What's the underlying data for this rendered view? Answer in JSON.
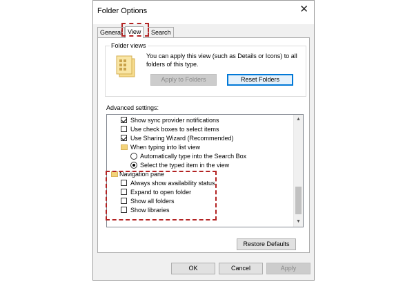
{
  "window": {
    "title": "Folder Options",
    "close_icon": "close-icon"
  },
  "tabs": [
    {
      "label": "General",
      "active": false
    },
    {
      "label": "View",
      "active": true
    },
    {
      "label": "Search",
      "active": false
    }
  ],
  "folder_views": {
    "group_label": "Folder views",
    "description": "You can apply this view (such as Details or Icons) to all folders of this type.",
    "apply_button": "Apply to Folders",
    "reset_button": "Reset Folders"
  },
  "advanced": {
    "label": "Advanced settings:",
    "items": [
      {
        "type": "checkbox",
        "label": "Show sync provider notifications",
        "checked": true
      },
      {
        "type": "checkbox",
        "label": "Use check boxes to select items",
        "checked": false
      },
      {
        "type": "checkbox",
        "label": "Use Sharing Wizard (Recommended)",
        "checked": true
      },
      {
        "type": "folder",
        "label": "When typing into list view"
      },
      {
        "type": "radio",
        "label": "Automatically type into the Search Box",
        "checked": false
      },
      {
        "type": "radio",
        "label": "Select the typed item in the view",
        "checked": true
      },
      {
        "type": "folder",
        "label": "Navigation pane"
      },
      {
        "type": "checkbox",
        "label": "Always show availability status",
        "checked": false
      },
      {
        "type": "checkbox",
        "label": "Expand to open folder",
        "checked": false
      },
      {
        "type": "checkbox",
        "label": "Show all folders",
        "checked": false
      },
      {
        "type": "checkbox",
        "label": "Show libraries",
        "checked": false
      }
    ]
  },
  "buttons": {
    "restore_defaults": "Restore Defaults",
    "ok": "OK",
    "cancel": "Cancel",
    "apply": "Apply"
  },
  "colors": {
    "highlight": "#b22222",
    "focus": "#0078d7",
    "folder": "#f3d37a"
  }
}
